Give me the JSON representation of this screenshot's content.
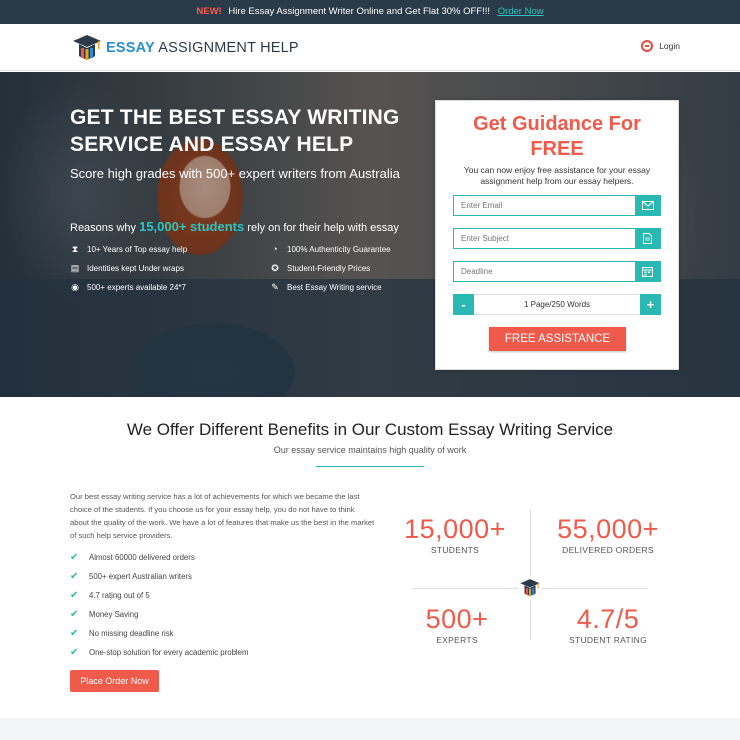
{
  "promo": {
    "badge": "NEW!",
    "text": "Hire Essay Assignment Writer Online and Get Flat 30% OFF!!!",
    "link": "Order Now"
  },
  "header": {
    "logo_highlight": "ESSAY",
    "logo_rest": " ASSIGNMENT HELP",
    "login": "Login"
  },
  "hero": {
    "title": "GET THE BEST ESSAY WRITING SERVICE AND ESSAY HELP",
    "subtitle": "Score high grades with 500+ expert writers from Australia",
    "reasons_prefix": "Reasons why ",
    "reasons_highlight": "15,000+ students",
    "reasons_suffix": " rely on for their help with essay",
    "reasons": [
      {
        "icon": "hourglass-icon",
        "glyph": "⧗",
        "label": "10+ Years of Top essay help"
      },
      {
        "icon": "clock-icon",
        "glyph": "◔",
        "label": "100% Authenticity Guarantee"
      },
      {
        "icon": "document-icon",
        "glyph": "▤",
        "label": "Identities kept Under wraps"
      },
      {
        "icon": "award-icon",
        "glyph": "✪",
        "label": "Student-Friendly Prices"
      },
      {
        "icon": "support-icon",
        "glyph": "◉",
        "label": "500+ experts available 24*7"
      },
      {
        "icon": "edit-icon",
        "glyph": "✎",
        "label": "Best Essay Writing service"
      }
    ]
  },
  "form": {
    "title": "Get Guidance For FREE",
    "desc": "You can now enjoy free assistance for your essay assignment help from our essay helpers.",
    "email_placeholder": "Enter Email",
    "subject_placeholder": "Enter Subject",
    "deadline_placeholder": "Deadline",
    "minus": "-",
    "pages": "1 Page/250 Words",
    "plus": "+",
    "submit": "FREE ASSISTANCE"
  },
  "benefits": {
    "title": "We Offer Different Benefits in Our Custom Essay Writing Service",
    "subtitle": "Our essay service maintains high quality of work",
    "paragraph": "Our best essay writing service has a lot of achievements for which we became the last choice of the students. If you choose us for your essay help, you do not have to think about the quality of the work. We have a lot of features that make us the best in the market of such help service providers.",
    "checks": [
      "Almost 60000 delivered orders",
      "500+ expert Australian writers",
      "4.7 rating out of 5",
      "Money Saving",
      "No missing deadline risk",
      "One-stop solution for every academic problem"
    ],
    "cta": "Place Order Now"
  },
  "stats": [
    {
      "num": "15,000+",
      "label": "STUDENTS"
    },
    {
      "num": "55,000+",
      "label": "DELIVERED ORDERS"
    },
    {
      "num": "500+",
      "label": "EXPERTS"
    },
    {
      "num": "4.7/5",
      "label": "STUDENT RATING"
    }
  ],
  "colors": {
    "accent": "#f05a4b",
    "teal": "#2ab8b3",
    "dark": "#2b3a48"
  }
}
